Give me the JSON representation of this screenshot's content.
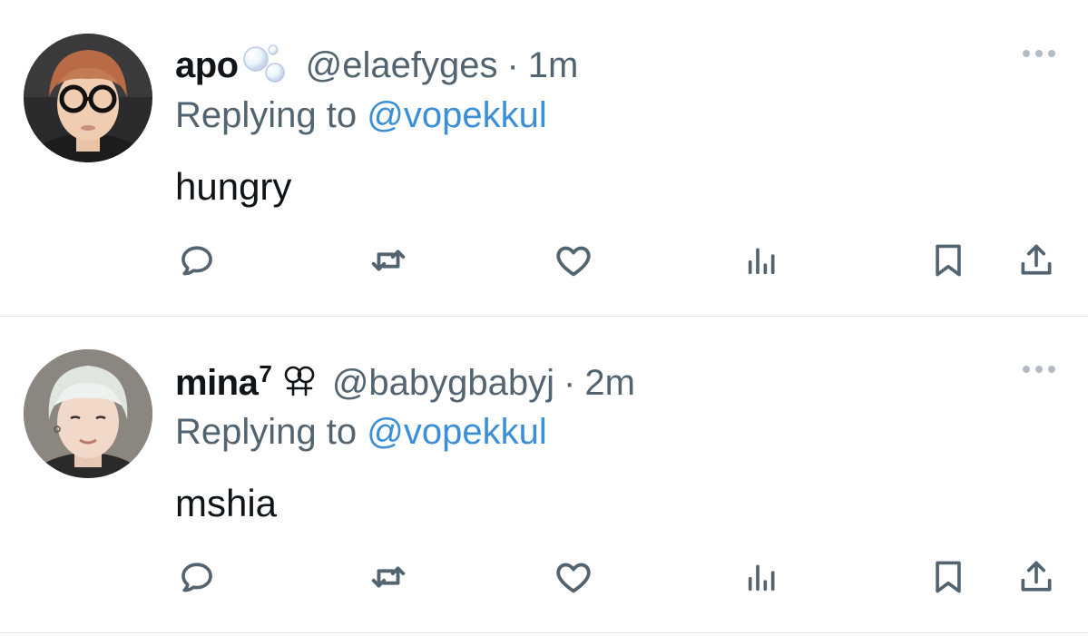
{
  "tweets": [
    {
      "display_name": "apo",
      "name_suffix": "",
      "name_emoji": "bubbles-emoji",
      "handle": "@elaefyges",
      "separator": "·",
      "time": "1m",
      "replying_prefix": "Replying to ",
      "replying_to": "@vopekkul",
      "text": "hungry",
      "avatar": "user-photo-round-glasses"
    },
    {
      "display_name": "mina",
      "name_suffix": "7",
      "name_emoji": "double-venus-symbol",
      "handle": "@babygbabyj",
      "separator": "·",
      "time": "2m",
      "replying_prefix": "Replying to ",
      "replying_to": "@vopekkul",
      "text": "mshia",
      "avatar": "user-photo-light-hair"
    }
  ],
  "action_icons": [
    "reply-icon",
    "retweet-icon",
    "like-icon",
    "views-icon",
    "bookmark-icon",
    "share-icon"
  ],
  "colors": {
    "text": "#0f1419",
    "secondary": "#536471",
    "link": "#3b8fd6",
    "divider": "#e1e6ea"
  }
}
